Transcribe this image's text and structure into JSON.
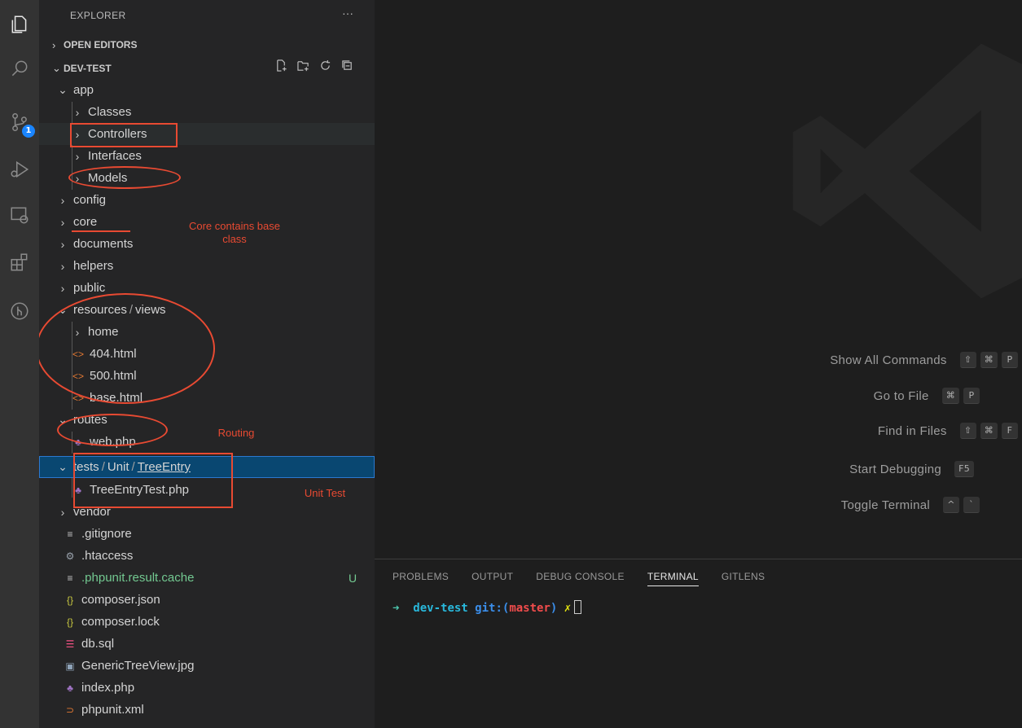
{
  "colors": {
    "annotation": "#e84a32",
    "selection": "#094771",
    "accent": "#1a85ff",
    "untracked": "#73c991"
  },
  "activity_bar": {
    "items": [
      "files-icon",
      "search-icon",
      "source-control-icon",
      "run-debug-icon",
      "remote-explorer-icon",
      "extensions-icon",
      "gitlens-icon"
    ],
    "source_control_badge": "1"
  },
  "sidebar": {
    "title": "EXPLORER",
    "more": "···",
    "open_editors": "OPEN EDITORS",
    "project": "DEV-TEST",
    "tree": [
      {
        "label": "app"
      },
      {
        "label": "Classes"
      },
      {
        "label": "Controllers"
      },
      {
        "label": "Interfaces"
      },
      {
        "label": "Models"
      },
      {
        "label": "config"
      },
      {
        "label": "core"
      },
      {
        "label": "documents"
      },
      {
        "label": "helpers"
      },
      {
        "label": "public"
      },
      {
        "label": "resources",
        "label2": "views"
      },
      {
        "label": "home"
      },
      {
        "label": "404.html"
      },
      {
        "label": "500.html"
      },
      {
        "label": "base.html"
      },
      {
        "label": "routes"
      },
      {
        "label": "web.php"
      },
      {
        "label": "tests",
        "label2": "Unit",
        "label3": "TreeEntry"
      },
      {
        "label": "TreeEntryTest.php"
      },
      {
        "label": "vendor"
      },
      {
        "label": ".gitignore"
      },
      {
        "label": ".htaccess"
      },
      {
        "label": ".phpunit.result.cache",
        "status": "U"
      },
      {
        "label": "composer.json"
      },
      {
        "label": "composer.lock"
      },
      {
        "label": "db.sql"
      },
      {
        "label": "GenericTreeView.jpg"
      },
      {
        "label": "index.php"
      },
      {
        "label": "phpunit.xml"
      }
    ]
  },
  "annotations": {
    "core_note": "Core contains base class",
    "routing_note": "Routing",
    "unit_test_note": "Unit Test"
  },
  "editor": {
    "commands": [
      {
        "label": "Show All Commands",
        "keys": [
          "⇧",
          "⌘",
          "P"
        ]
      },
      {
        "label": "Go to File",
        "keys": [
          "⌘",
          "P"
        ]
      },
      {
        "label": "Find in Files",
        "keys": [
          "⇧",
          "⌘",
          "F"
        ]
      },
      {
        "label": "Start Debugging",
        "keys": [
          "F5"
        ]
      },
      {
        "label": "Toggle Terminal",
        "keys": [
          "^",
          "`"
        ]
      }
    ]
  },
  "panel": {
    "tabs": [
      "PROBLEMS",
      "OUTPUT",
      "DEBUG CONSOLE",
      "TERMINAL",
      "GITLENS"
    ],
    "active_tab": "TERMINAL",
    "terminal": {
      "arrow": "➜",
      "dir": "dev-test",
      "git": "git:(",
      "branch": "master",
      "close": ")",
      "dirty": "✗"
    }
  }
}
